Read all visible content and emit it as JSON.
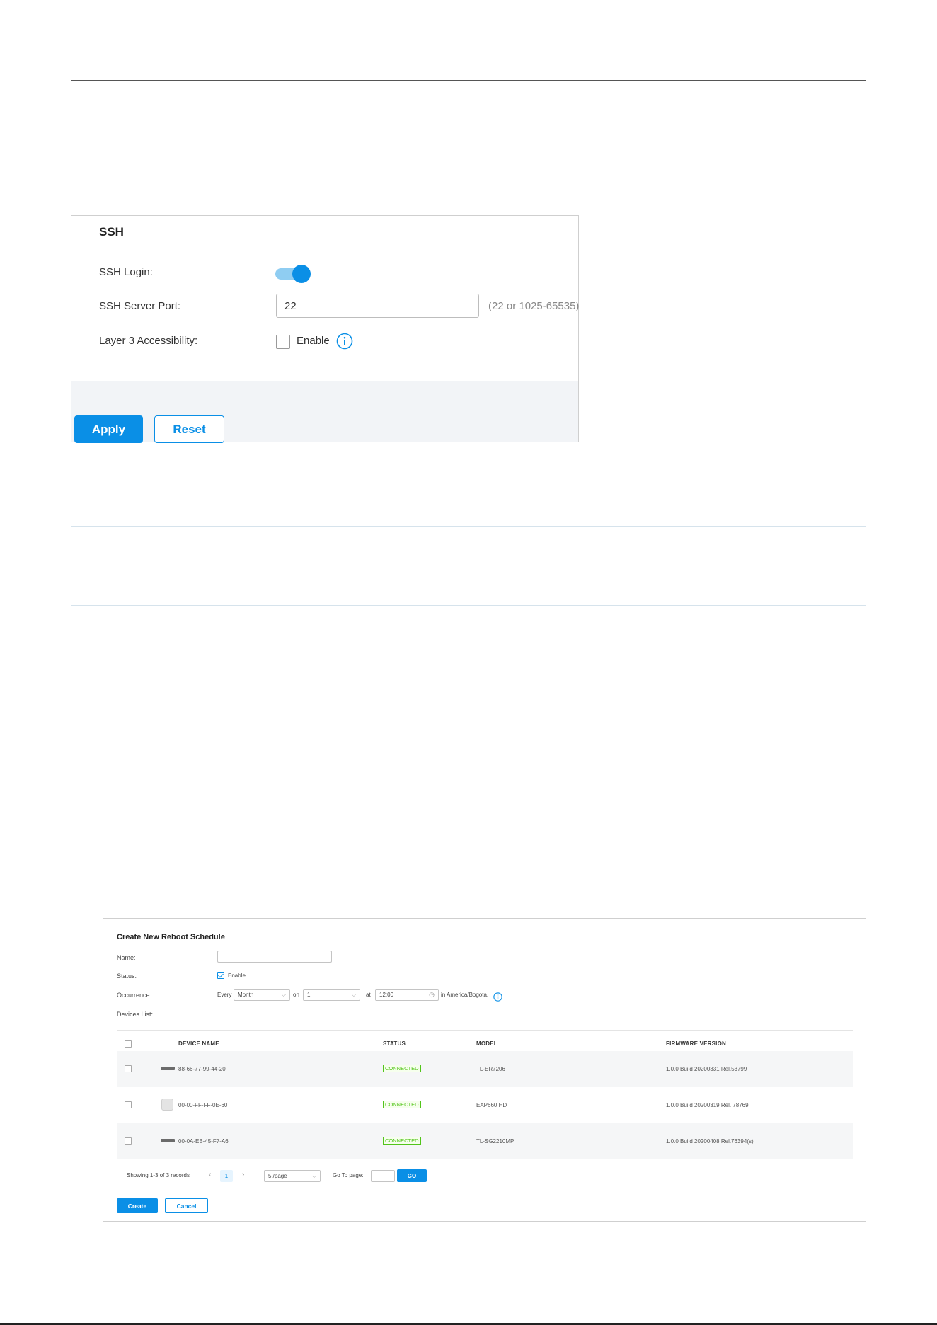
{
  "ssh": {
    "title": "SSH",
    "login_label": "SSH Login:",
    "login_enabled": true,
    "port_label": "SSH Server Port:",
    "port_value": "22",
    "port_hint": "(22 or 1025-65535)",
    "l3_label": "Layer 3 Accessibility:",
    "l3_checkbox_label": "Enable",
    "l3_enabled": false,
    "apply_label": "Apply",
    "reset_label": "Reset"
  },
  "reboot": {
    "title": "Create New Reboot Schedule",
    "name_label": "Name:",
    "name_value": "",
    "status_label": "Status:",
    "status_checkbox_label": "Enable",
    "status_enabled": true,
    "occurrence_label": "Occurrence:",
    "every_label": "Every",
    "period_value": "Month",
    "on_label": "on",
    "day_value": "1",
    "at_label": "at",
    "time_value": "12:00",
    "timezone_text": "in America/Bogota.",
    "devices_label": "Devices List:",
    "columns": {
      "device_name": "DEVICE NAME",
      "status": "STATUS",
      "model": "MODEL",
      "firmware": "FIRMWARE VERSION"
    },
    "rows": [
      {
        "device_name": "88-66-77-99-44-20",
        "status": "CONNECTED",
        "model": "TL-ER7206",
        "firmware": "1.0.0 Build 20200331 Rel.53799",
        "icon": "router-icon"
      },
      {
        "device_name": "00-00-FF-FF-0E-60",
        "status": "CONNECTED",
        "model": "EAP660 HD",
        "firmware": "1.0.0 Build 20200319 Rel. 78769",
        "icon": "access-point-icon"
      },
      {
        "device_name": "00-0A-EB-45-F7-A6",
        "status": "CONNECTED",
        "model": "TL-SG2210MP",
        "firmware": "1.0.0 Build 20200408 Rel.76394(s)",
        "icon": "switch-icon"
      }
    ],
    "pagination": {
      "summary": "Showing 1-3 of 3 records",
      "current_page": "1",
      "page_size": "5 /page",
      "goto_label": "Go To page:",
      "goto_value": "",
      "go_label": "GO"
    },
    "create_label": "Create",
    "cancel_label": "Cancel"
  },
  "colors": {
    "accent": "#0a8fe6",
    "connected": "#52c41a",
    "footer_bg": "#f2f4f7"
  }
}
